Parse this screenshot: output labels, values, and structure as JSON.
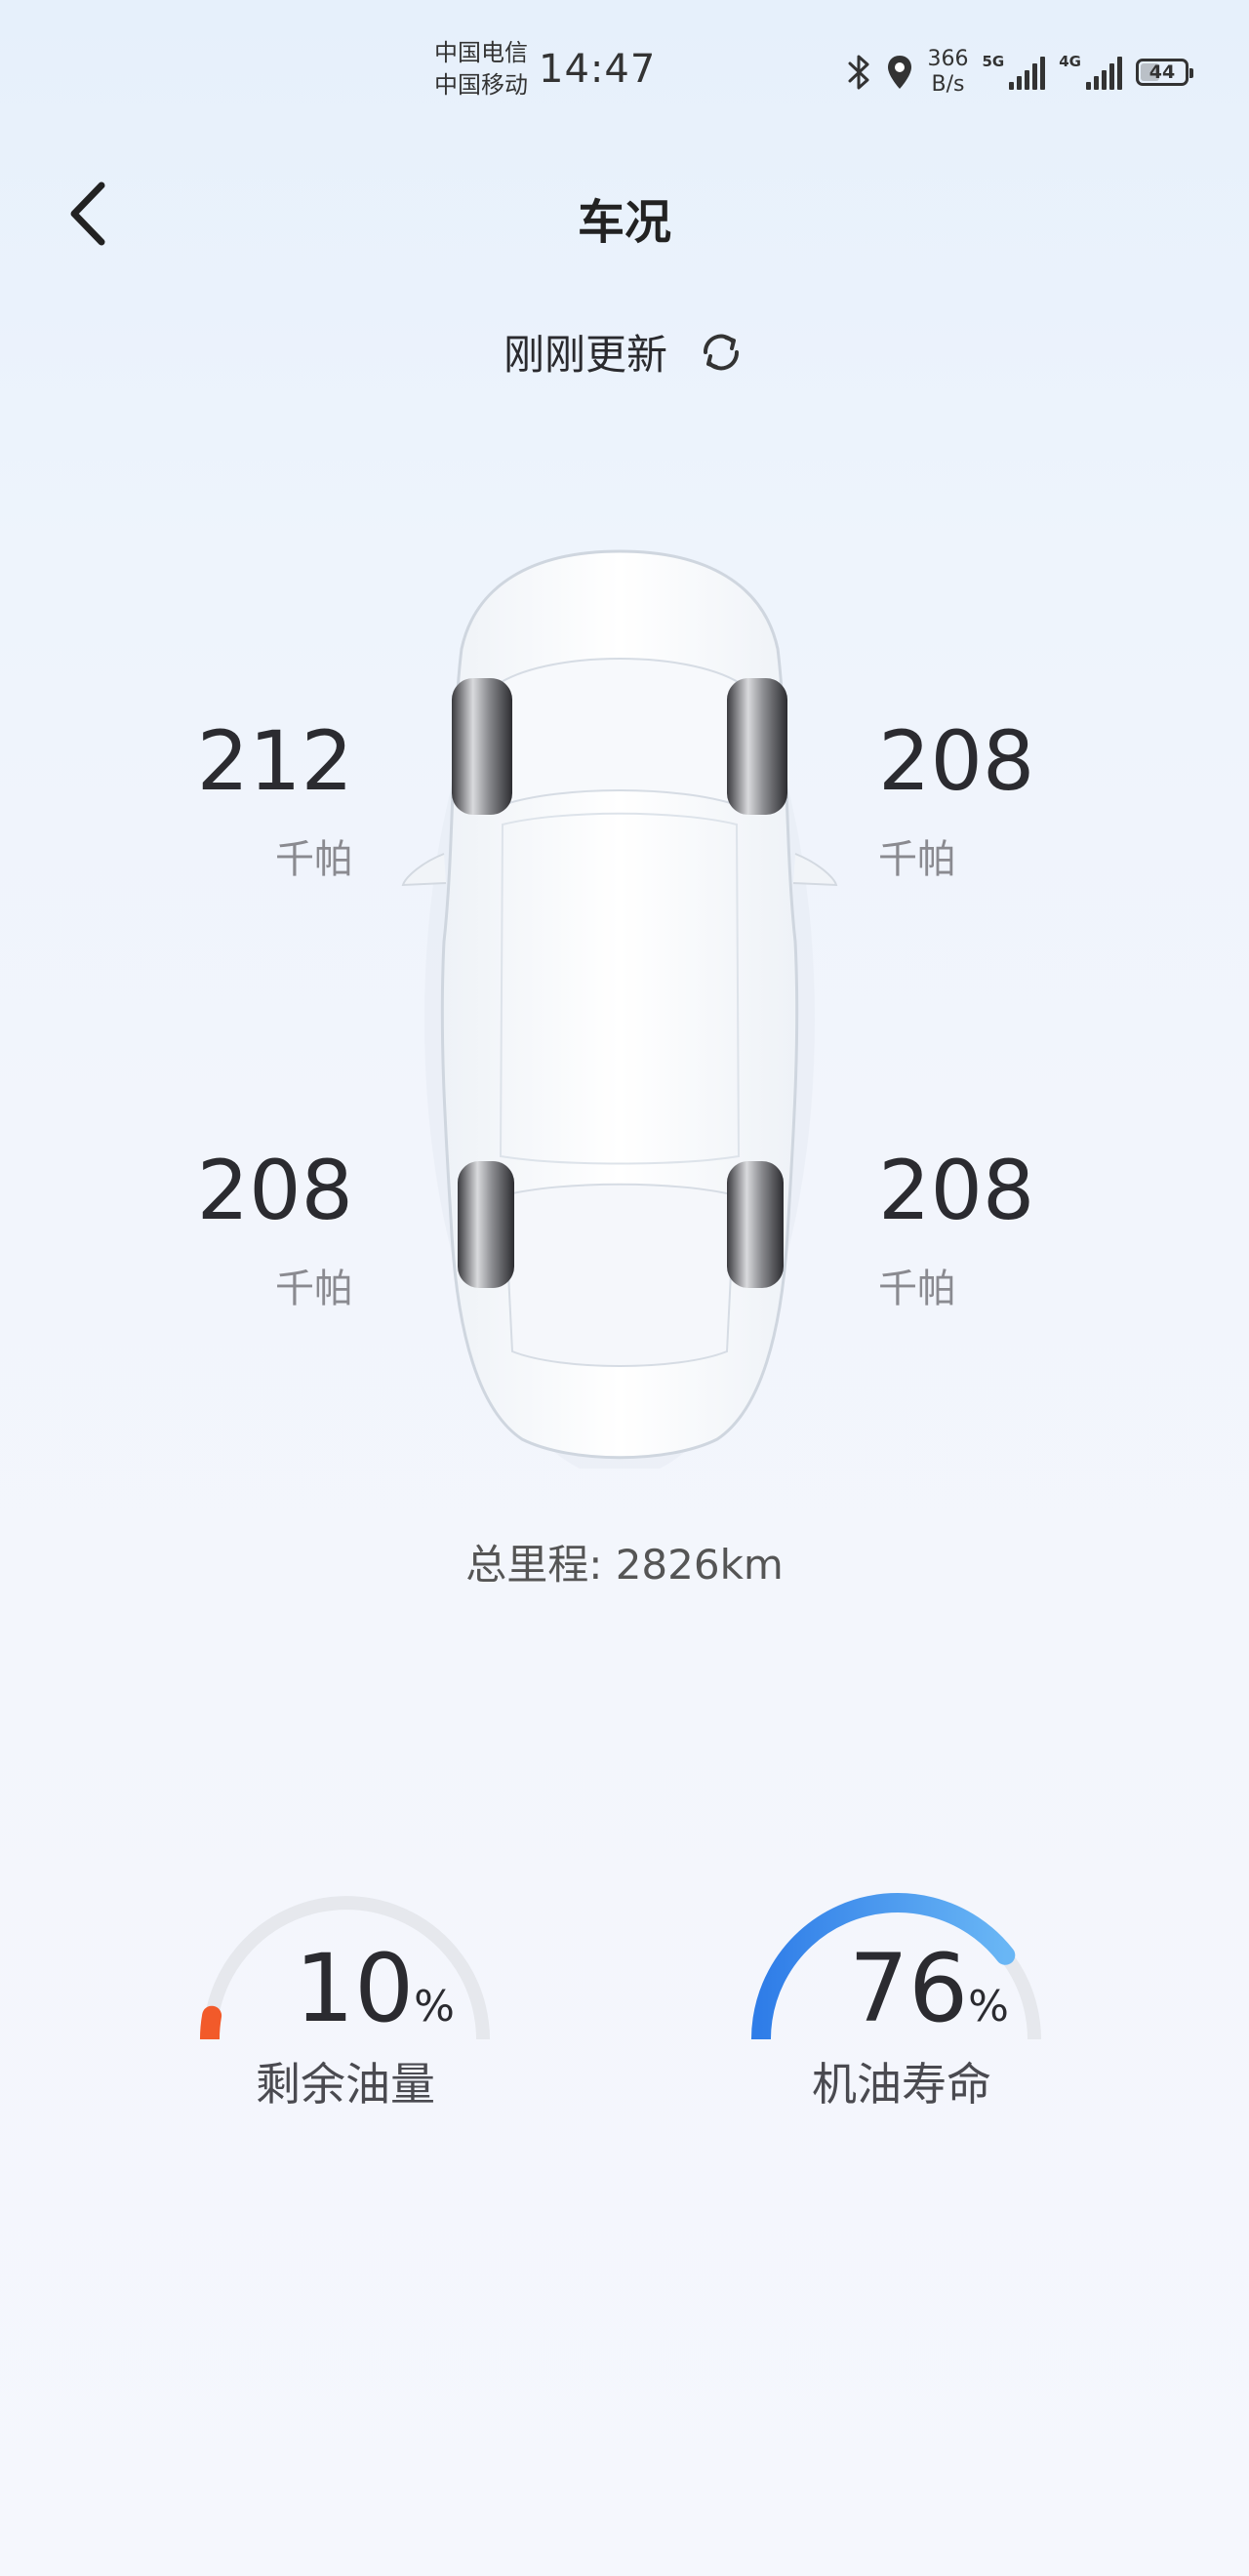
{
  "status_bar": {
    "carrier_1": "中国电信",
    "carrier_2": "中国移动",
    "time": "14:47",
    "net_speed_value": "366",
    "net_speed_unit": "B/s",
    "sim1_tag": "5G",
    "sim2_tag": "4G",
    "battery": "44",
    "battery_level_pct": 44,
    "icons": [
      "bluetooth-icon",
      "location-icon",
      "signal-5g-icon",
      "signal-4g-icon",
      "battery-icon"
    ]
  },
  "header": {
    "title": "车况",
    "update_text": "刚刚更新"
  },
  "tyres": {
    "front_left": {
      "value": "212",
      "unit": "千帕"
    },
    "front_right": {
      "value": "208",
      "unit": "千帕"
    },
    "rear_left": {
      "value": "208",
      "unit": "千帕"
    },
    "rear_right": {
      "value": "208",
      "unit": "千帕"
    }
  },
  "odometer": "总里程: 2826km",
  "gauges": {
    "fuel": {
      "value": "10",
      "unit": "%",
      "label": "剩余油量",
      "level_pct": 10,
      "color": "#f25a2a"
    },
    "oil": {
      "value": "76",
      "unit": "%",
      "label": "机油寿命",
      "level_pct": 76,
      "color": "#2f7de8"
    }
  }
}
